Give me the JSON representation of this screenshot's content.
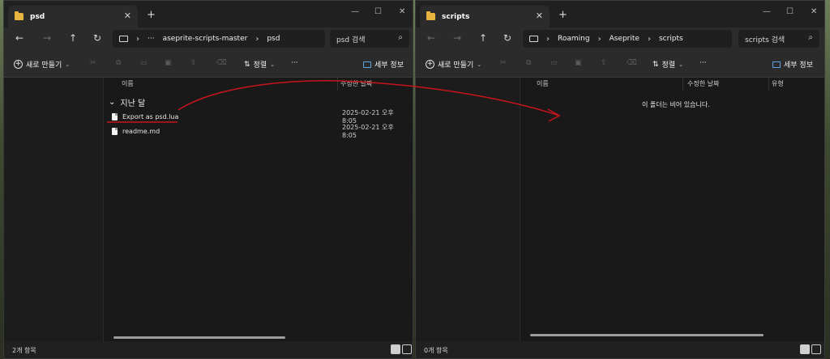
{
  "left": {
    "tab_title": "psd",
    "close_glyph": "✕",
    "new_tab_glyph": "+",
    "breadcrumb": [
      "···",
      "aseprite-scripts-master",
      "psd"
    ],
    "search_placeholder": "psd 검색",
    "new_button": "새로 만들기",
    "sort_button": "정렬",
    "more_glyph": "···",
    "details_button": "세부 정보",
    "col_name": "이름",
    "col_modified": "수정한 날짜",
    "group_label": "지난 달",
    "files": [
      {
        "name": "Export as psd.lua",
        "modified": "2025-02-21 오후 8:05"
      },
      {
        "name": "readme.md",
        "modified": "2025-02-21 오후 8:05"
      }
    ],
    "status": "2개 항목"
  },
  "right": {
    "tab_title": "scripts",
    "close_glyph": "✕",
    "new_tab_glyph": "+",
    "breadcrumb": [
      "Roaming",
      "Aseprite",
      "scripts"
    ],
    "search_placeholder": "scripts 검색",
    "new_button": "새로 만들기",
    "sort_button": "정렬",
    "more_glyph": "···",
    "details_button": "세부 정보",
    "col_name": "이름",
    "col_modified": "수정한 날짜",
    "col_type": "유형",
    "empty_message": "이 폴더는 비어 있습니다.",
    "status": "0개 항목"
  },
  "icons": {
    "back": "←",
    "forward": "→",
    "up": "↑",
    "refresh": "↻",
    "chevron": "›",
    "search": "⌕",
    "minimize": "—",
    "maximize": "☐",
    "close": "✕",
    "cut": "✂",
    "collapse": "⌄"
  },
  "colors": {
    "annotation": "#c8141e",
    "folder": "#e7b540",
    "accent": "#5ca3e6"
  }
}
